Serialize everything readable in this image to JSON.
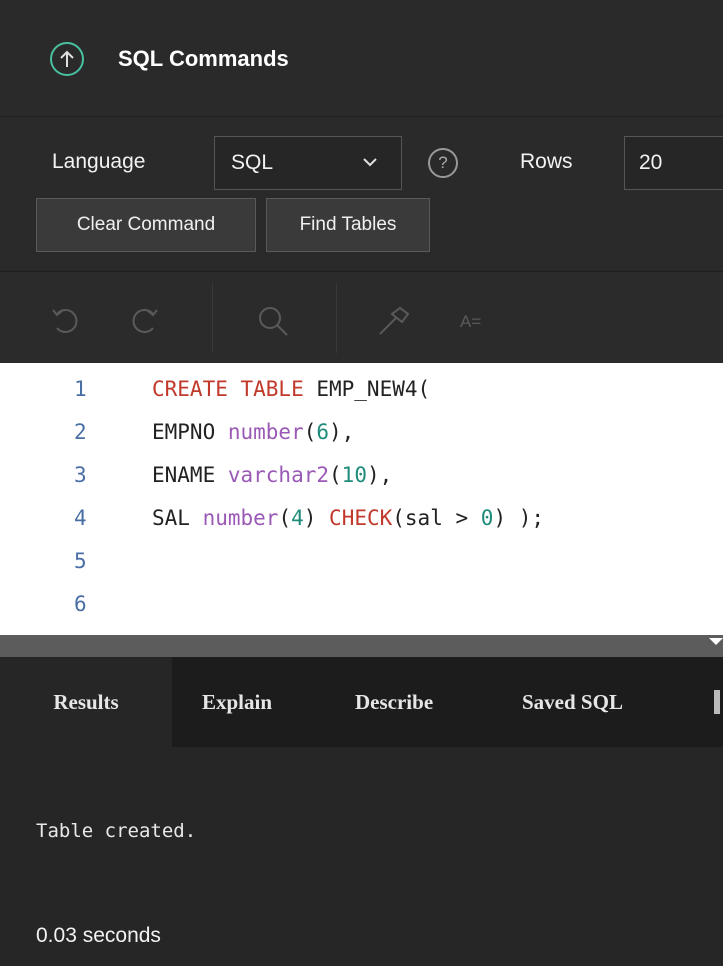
{
  "header": {
    "title": "SQL Commands",
    "icon": "arrow-up-circle-icon",
    "icon_color": "#49c0a0"
  },
  "toolbar": {
    "language_label": "Language",
    "language_value": "SQL",
    "rows_label": "Rows",
    "rows_value": "20",
    "clear_button": "Clear Command",
    "find_tables_button": "Find Tables"
  },
  "editor_toolbar": {
    "icons": [
      "undo-icon",
      "redo-icon",
      "search-icon",
      "hammer-icon",
      "format-text-icon"
    ],
    "format_label": "A="
  },
  "editor": {
    "lines": [
      {
        "num": "1",
        "tokens": [
          {
            "t": "CREATE TABLE",
            "c": "kw"
          },
          {
            "t": " EMP_NEW4(",
            "c": ""
          }
        ]
      },
      {
        "num": "2",
        "tokens": [
          {
            "t": "EMPNO ",
            "c": ""
          },
          {
            "t": "number",
            "c": "ty"
          },
          {
            "t": "(",
            "c": ""
          },
          {
            "t": "6",
            "c": "num"
          },
          {
            "t": "),",
            "c": ""
          }
        ]
      },
      {
        "num": "3",
        "tokens": [
          {
            "t": "ENAME ",
            "c": ""
          },
          {
            "t": "varchar2",
            "c": "ty"
          },
          {
            "t": "(",
            "c": ""
          },
          {
            "t": "10",
            "c": "num"
          },
          {
            "t": "),",
            "c": ""
          }
        ]
      },
      {
        "num": "4",
        "tokens": [
          {
            "t": "SAL ",
            "c": ""
          },
          {
            "t": "number",
            "c": "ty"
          },
          {
            "t": "(",
            "c": ""
          },
          {
            "t": "4",
            "c": "num"
          },
          {
            "t": ") ",
            "c": ""
          },
          {
            "t": "CHECK",
            "c": "fn"
          },
          {
            "t": "(sal > ",
            "c": ""
          },
          {
            "t": "0",
            "c": "num"
          },
          {
            "t": ") );",
            "c": ""
          }
        ]
      },
      {
        "num": "5",
        "tokens": []
      },
      {
        "num": "6",
        "tokens": []
      }
    ]
  },
  "tabs": [
    {
      "label": "Results",
      "active": true
    },
    {
      "label": "Explain",
      "active": false
    },
    {
      "label": "Describe",
      "active": false
    },
    {
      "label": "Saved SQL",
      "active": false
    }
  ],
  "results": {
    "message": "Table created.",
    "timing": "0.03 seconds"
  }
}
